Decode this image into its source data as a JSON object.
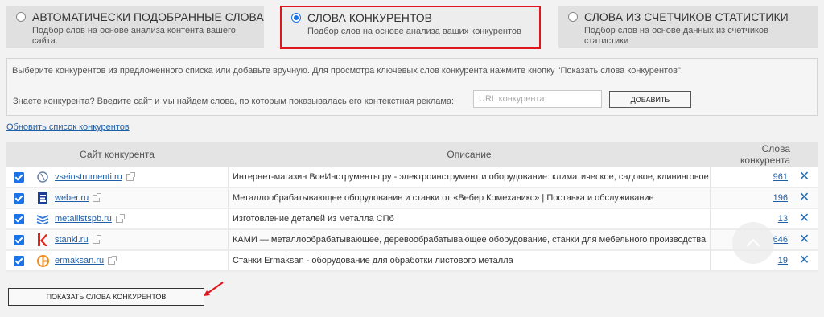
{
  "modes": [
    {
      "title": "АВТОМАТИЧЕСКИ ПОДОБРАННЫЕ СЛОВА",
      "subtitle": "Подбор слов на основе анализа контента вашего сайта.",
      "selected": false
    },
    {
      "title": "СЛОВА КОНКУРЕНТОВ",
      "subtitle": "Подбор слов на основе анализа ваших конкурентов",
      "selected": true
    },
    {
      "title": "СЛОВА ИЗ СЧЕТЧИКОВ СТАТИСТИКИ",
      "subtitle": "Подбор слов на основе данных из счетчиков статистики",
      "selected": false
    }
  ],
  "info": {
    "hint": "Выберите конкурентов из предложенного списка или добавьте вручную. Для просмотра ключевых слов конкурента нажмите кнопку \"Показать слова конкурентов\".",
    "question": "Знаете конкурента? Введите сайт и мы найдем слова, по которым показывалась его контекстная реклама:",
    "url_placeholder": "URL конкурента",
    "add_label": "ДОБАВИТЬ"
  },
  "refresh_label": "Обновить список конкурентов",
  "table": {
    "headers": {
      "site": "Сайт конкурента",
      "description": "Описание",
      "count": "Слова конкурента"
    },
    "rows": [
      {
        "site": "vseinstrumenti.ru",
        "description": "Интернет-магазин ВсеИнструменты.ру - электроинструмент и оборудование: климатическое, садовое, клининговое",
        "count": "961",
        "checked": true,
        "icon": "globe-icon"
      },
      {
        "site": "weber.ru",
        "description": "Металлообрабатывающее оборудование и станки от «Вебер Комеханикс» | Поставка и обслуживание",
        "count": "196",
        "checked": true,
        "icon": "weber-logo-icon"
      },
      {
        "site": "metallistspb.ru",
        "description": "Изготовление деталей из металла СПб",
        "count": "13",
        "checked": true,
        "icon": "metallist-logo-icon"
      },
      {
        "site": "stanki.ru",
        "description": "КАМИ — металлообрабатывающее, деревообрабатывающее оборудование, станки для мебельного производства",
        "count": "646",
        "checked": true,
        "icon": "stanki-logo-icon"
      },
      {
        "site": "ermaksan.ru",
        "description": "Станки Ermaksan - оборудование для обработки листового металла",
        "count": "19",
        "checked": true,
        "icon": "ermaksan-logo-icon"
      }
    ]
  },
  "show_label": "ПОКАЗАТЬ СЛОВА КОНКУРЕНТОВ",
  "colors": {
    "accent": "#1a73e8",
    "highlight_border": "#e0161d",
    "link": "#1f5fa8"
  }
}
